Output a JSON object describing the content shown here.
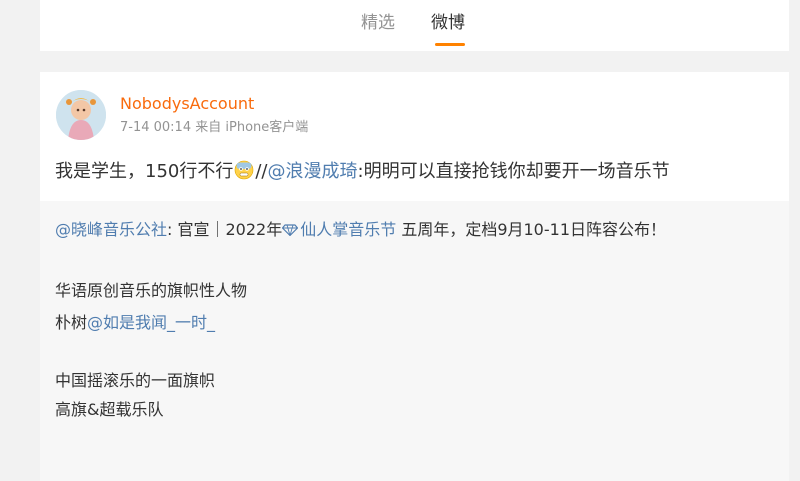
{
  "tabs": [
    {
      "label": "精选",
      "active": false
    },
    {
      "label": "微博",
      "active": true
    }
  ],
  "colors": {
    "accent": "#ff8200",
    "username": "#f96b0d",
    "link": "#507daf",
    "muted": "#939393"
  },
  "post": {
    "username": "NobodysAccount",
    "timestamp": "7-14 00:14",
    "source_prefix": "来自",
    "source": "iPhone客户端",
    "text_main": "我是学生，150行不行",
    "emoji_icon": "scared-face-icon",
    "repost_sep": "//",
    "mention": "@浪漫成琦",
    "text_after_mention": ":明明可以直接抢钱你却要开一场音乐节"
  },
  "repost": {
    "author": "@晓峰音乐公社",
    "line1_a": ": 官宣｜2022年",
    "topic_icon": "diamond-icon",
    "topic": "仙人掌音乐节",
    "line1_b": " 五周年，定档9月10-11日阵容公布！",
    "line2": "华语原创音乐的旗帜性人物",
    "line3_prefix": "朴树",
    "line3_mention": "@如是我闻_一时_",
    "line4": "中国摇滚乐的一面旗帜",
    "line5": "高旗&超载乐队"
  }
}
